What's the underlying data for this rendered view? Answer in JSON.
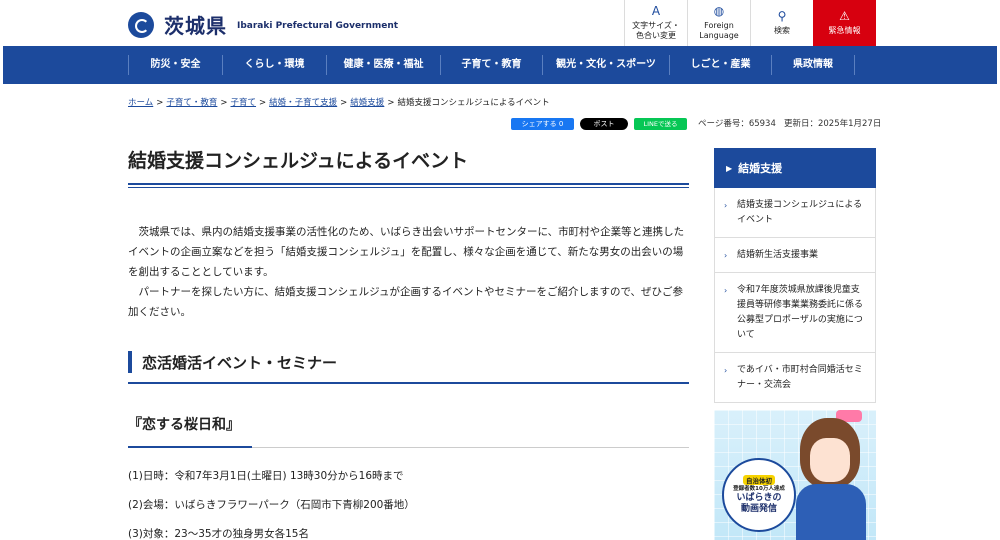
{
  "header": {
    "logo_jp": "茨城県",
    "logo_en": "Ibaraki Prefectural Government",
    "tools": [
      {
        "icon": "text-size-icon",
        "glyph": "A",
        "label": "文字サイズ・\n色合い変更"
      },
      {
        "icon": "globe-icon",
        "glyph": "◍",
        "label": "Foreign\nLanguage"
      },
      {
        "icon": "search-icon",
        "glyph": "⚲",
        "label": "検索"
      },
      {
        "icon": "warning-icon",
        "glyph": "⚠",
        "label": "緊急情報"
      }
    ]
  },
  "nav": {
    "items": [
      "防災・安全",
      "くらし・環境",
      "健康・医療・福祉",
      "子育て・教育",
      "観光・文化・スポーツ",
      "しごと・産業",
      "県政情報"
    ]
  },
  "breadcrumb": {
    "links": [
      "ホーム",
      "子育て・教育",
      "子育て",
      "結婚・子育て支援",
      "結婚支援"
    ],
    "current": "結婚支援コンシェルジュによるイベント"
  },
  "share": {
    "facebook": "シェアする 0",
    "x": "ポスト",
    "line": "LINEで送る"
  },
  "meta": {
    "page_number": "ページ番号：65934",
    "updated": "更新日：2025年1月27日"
  },
  "main": {
    "title": "結婚支援コンシェルジュによるイベント",
    "paragraphs": [
      "茨城県では、県内の結婚支援事業の活性化のため、いばらき出会いサポートセンターに、市町村や企業等と連携したイベントの企画立案などを担う「結婚支援コンシェルジュ」を配置し、様々な企画を通じて、新たな男女の出会いの場を創出することとしています。",
      "パートナーを探したい方に、結婚支援コンシェルジュが企画するイベントやセミナーをご紹介しますので、ぜひご参加ください。"
    ],
    "h2": "恋活婚活イベント・セミナー",
    "h3": "『恋する桜日和』",
    "details": [
      "(1)日時：令和7年3月1日(土曜日) 13時30分から16時まで",
      "(2)会場：いばらきフラワーパーク（石岡市下青柳200番地）",
      "(3)対象：23～35才の独身男女各15名"
    ]
  },
  "sidebar": {
    "heading": "結婚支援",
    "items": [
      "結婚支援コンシェルジュによるイベント",
      "結婚新生活支援事業",
      "令和7年度茨城県放課後児童支援員等研修事業業務委託に係る公募型プロポーザルの実施について",
      "であイバ・市町村合同婚活セミナー・交流会"
    ]
  },
  "banner": {
    "badge": "自治体初",
    "sub": "登録者数10万人達成",
    "title": "いばらきの\n動画発信"
  }
}
